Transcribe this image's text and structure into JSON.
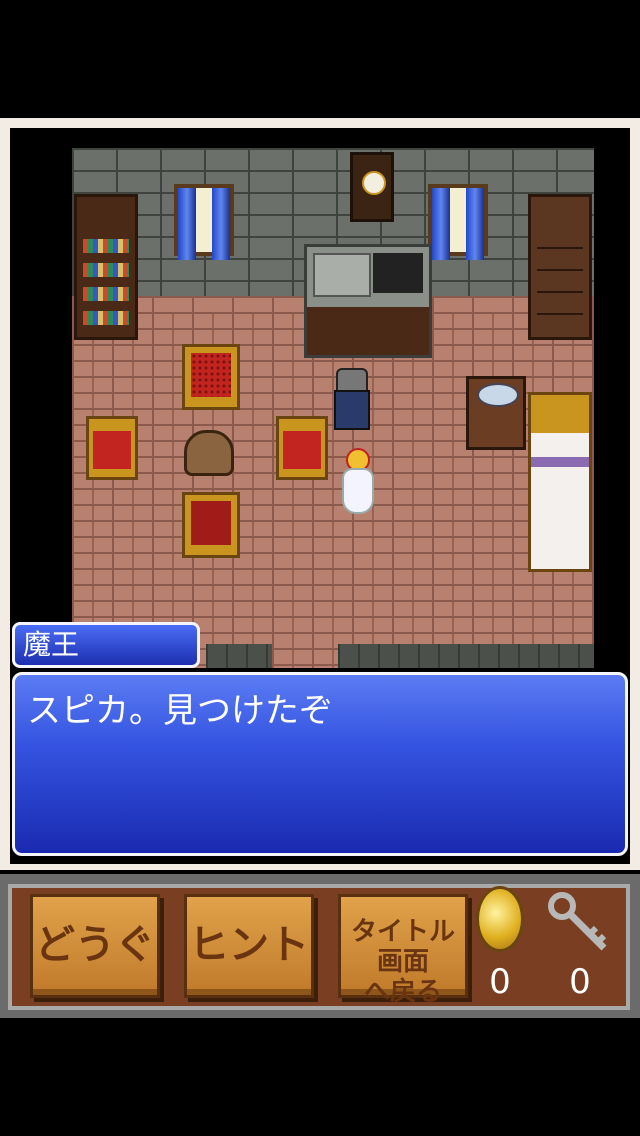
{
  "dialog": {
    "speaker": "魔王",
    "message": "スピカ。見つけたぞ"
  },
  "toolbar": {
    "items_button": "どうぐ",
    "hint_button": "ヒント",
    "title_button_line1": "タイトル画面",
    "title_button_line2": "へ戻る",
    "coin_count": "0",
    "key_count": "0"
  },
  "icons": {
    "coin": "gold-coin-icon",
    "key": "key-icon"
  },
  "colors": {
    "dialog_blue": "#3453e0",
    "button_gold": "#d08a35",
    "frame": "#f3ece4"
  }
}
